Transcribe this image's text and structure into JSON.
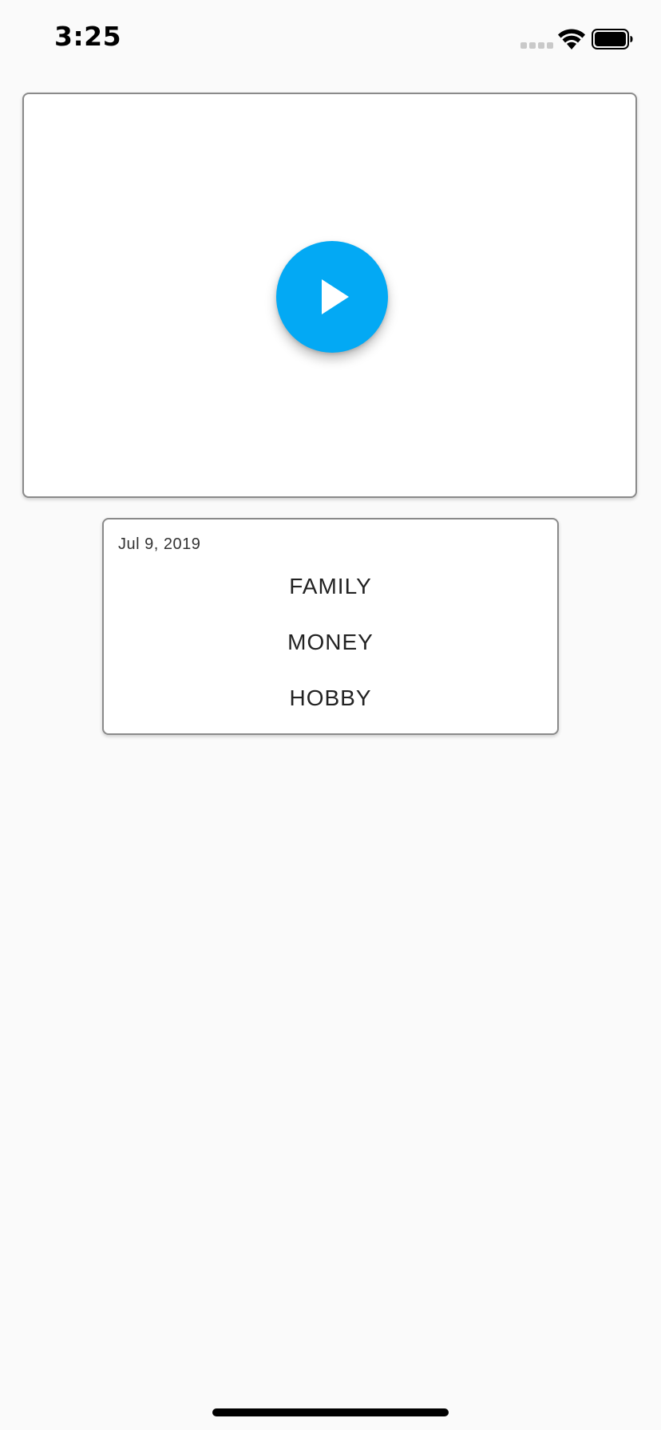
{
  "status_bar": {
    "time": "3:25",
    "signal_icon": "cellular-signal-icon",
    "wifi_icon": "wifi-icon",
    "battery_icon": "battery-icon"
  },
  "video": {
    "play_icon": "play-icon",
    "accent_color": "#03a9f4"
  },
  "entry": {
    "date": "Jul 9, 2019",
    "categories": [
      {
        "label": "FAMILY"
      },
      {
        "label": "MONEY"
      },
      {
        "label": "HOBBY"
      }
    ]
  }
}
